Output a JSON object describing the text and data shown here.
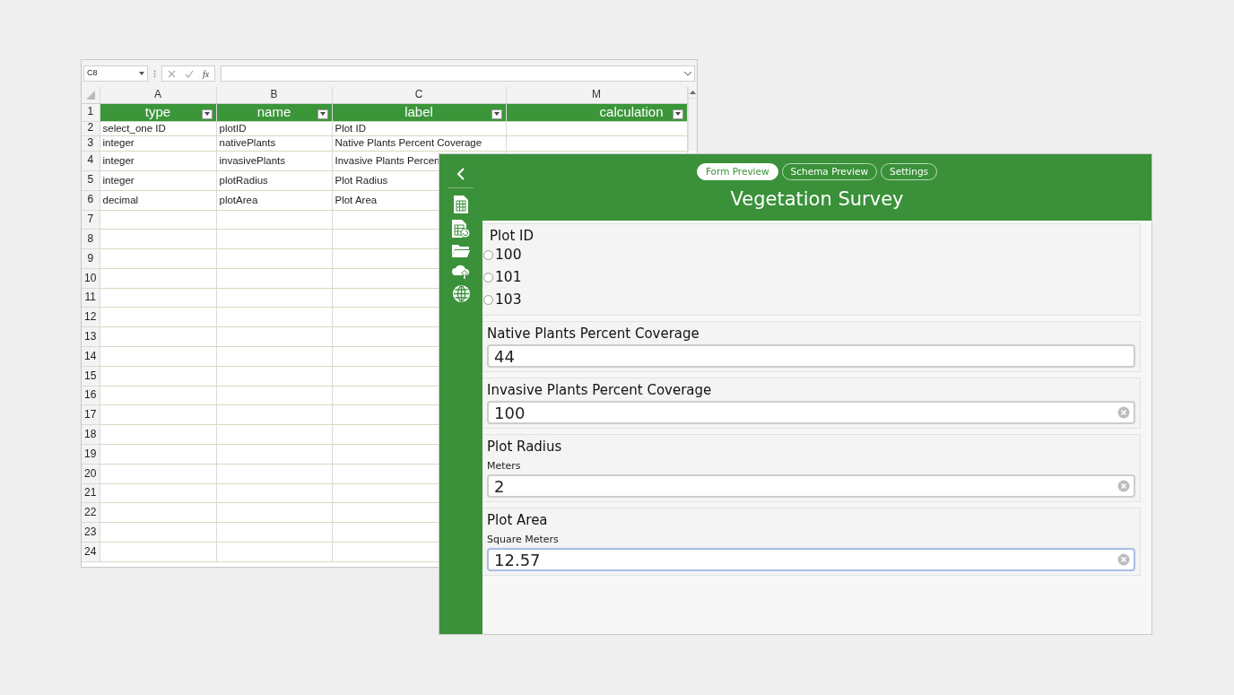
{
  "spreadsheet": {
    "name_box": "C8",
    "function_button": "fx",
    "columns": [
      "A",
      "B",
      "C",
      "M"
    ],
    "rows": [
      {
        "number": "1",
        "kind": "header",
        "cells": [
          "type",
          "name",
          "label",
          "calculation"
        ]
      },
      {
        "number": "2",
        "kind": "data",
        "cells": [
          "select_one ID",
          "plotID",
          "Plot ID"
        ]
      },
      {
        "number": "3",
        "kind": "data",
        "cells": [
          "integer",
          "nativePlants",
          "Native Plants Percent Coverage"
        ]
      },
      {
        "number": "4",
        "kind": "data",
        "cells": [
          "integer",
          "invasivePlants",
          "Invasive Plants Percen"
        ]
      },
      {
        "number": "5",
        "kind": "data",
        "cells": [
          "integer",
          "plotRadius",
          "Plot Radius"
        ]
      },
      {
        "number": "6",
        "kind": "data",
        "cells": [
          "decimal",
          "plotArea",
          "Plot Area"
        ]
      },
      {
        "number": "7",
        "kind": "data"
      },
      {
        "number": "8",
        "kind": "data"
      },
      {
        "number": "9",
        "kind": "data"
      },
      {
        "number": "10",
        "kind": "data"
      },
      {
        "number": "11",
        "kind": "data"
      },
      {
        "number": "12",
        "kind": "data"
      },
      {
        "number": "13",
        "kind": "data"
      },
      {
        "number": "14",
        "kind": "data"
      },
      {
        "number": "15",
        "kind": "data"
      },
      {
        "number": "16",
        "kind": "data"
      },
      {
        "number": "17",
        "kind": "data"
      },
      {
        "number": "18",
        "kind": "data"
      },
      {
        "number": "19",
        "kind": "data"
      },
      {
        "number": "20",
        "kind": "data"
      },
      {
        "number": "21",
        "kind": "data"
      },
      {
        "number": "22",
        "kind": "data"
      },
      {
        "number": "23",
        "kind": "data"
      },
      {
        "number": "24",
        "kind": "data"
      }
    ]
  },
  "app": {
    "tabs": [
      {
        "label": "Form Preview",
        "selected": true
      },
      {
        "label": "Schema Preview",
        "selected": false
      },
      {
        "label": "Settings",
        "selected": false
      }
    ],
    "title": "Vegetation Survey",
    "fields": [
      {
        "kind": "radio",
        "label": "Plot ID",
        "options": [
          {
            "label": "100",
            "selected": false
          },
          {
            "label": "101",
            "selected": false
          },
          {
            "label": "103",
            "selected": false
          }
        ]
      },
      {
        "kind": "text",
        "label": "Native Plants Percent Coverage",
        "value": "44",
        "clear_button": false,
        "focused": false
      },
      {
        "kind": "text",
        "label": "Invasive Plants Percent Coverage",
        "value": "100",
        "clear_button": true,
        "focused": false
      },
      {
        "kind": "text",
        "label": "Plot Radius",
        "hint": "Meters",
        "value": "2",
        "clear_button": true,
        "focused": false
      },
      {
        "kind": "text",
        "label": "Plot Area",
        "hint": "Square Meters",
        "value": "12.57",
        "clear_button": true,
        "focused": true
      }
    ]
  }
}
